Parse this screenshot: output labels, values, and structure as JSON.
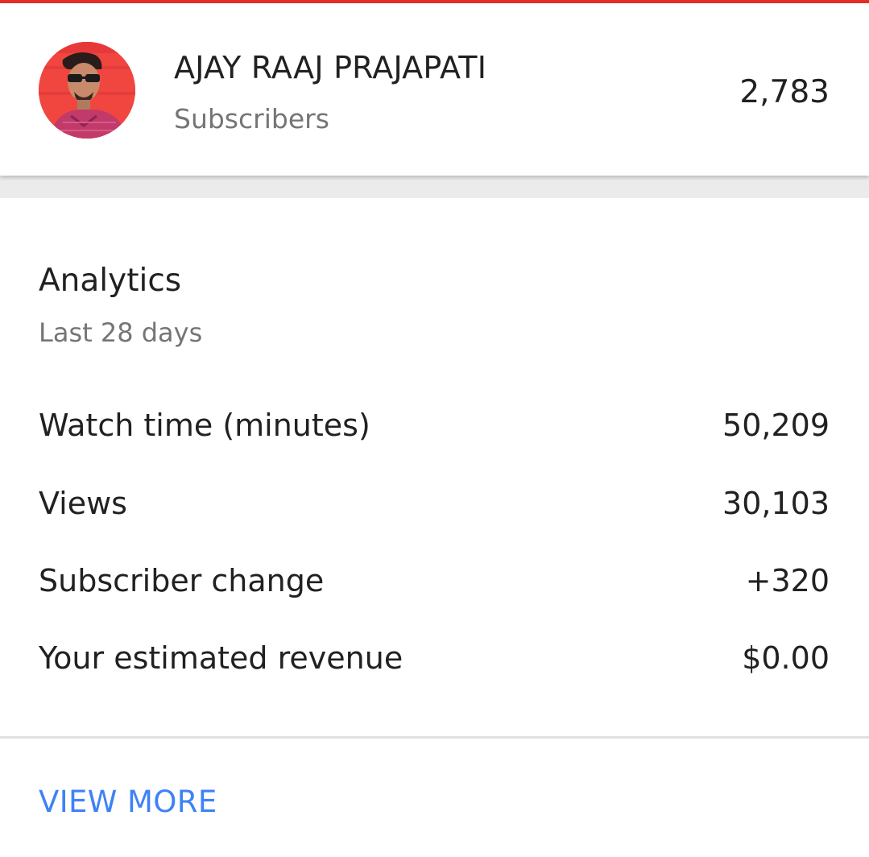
{
  "accent_color": "#e52d27",
  "link_color": "#3e82f7",
  "channel": {
    "name": "AJAY RAAJ PRAJAPATI",
    "subscribers_label": "Subscribers",
    "subscribers_count": "2,783",
    "avatar_icon": "channel-avatar-photo"
  },
  "analytics": {
    "title": "Analytics",
    "period": "Last 28 days",
    "metrics": [
      {
        "label": "Watch time (minutes)",
        "value": "50,209"
      },
      {
        "label": "Views",
        "value": "30,103"
      },
      {
        "label": "Subscriber change",
        "value": "+320"
      },
      {
        "label": "Your estimated revenue",
        "value": "$0.00"
      }
    ],
    "view_more_label": "VIEW MORE"
  }
}
